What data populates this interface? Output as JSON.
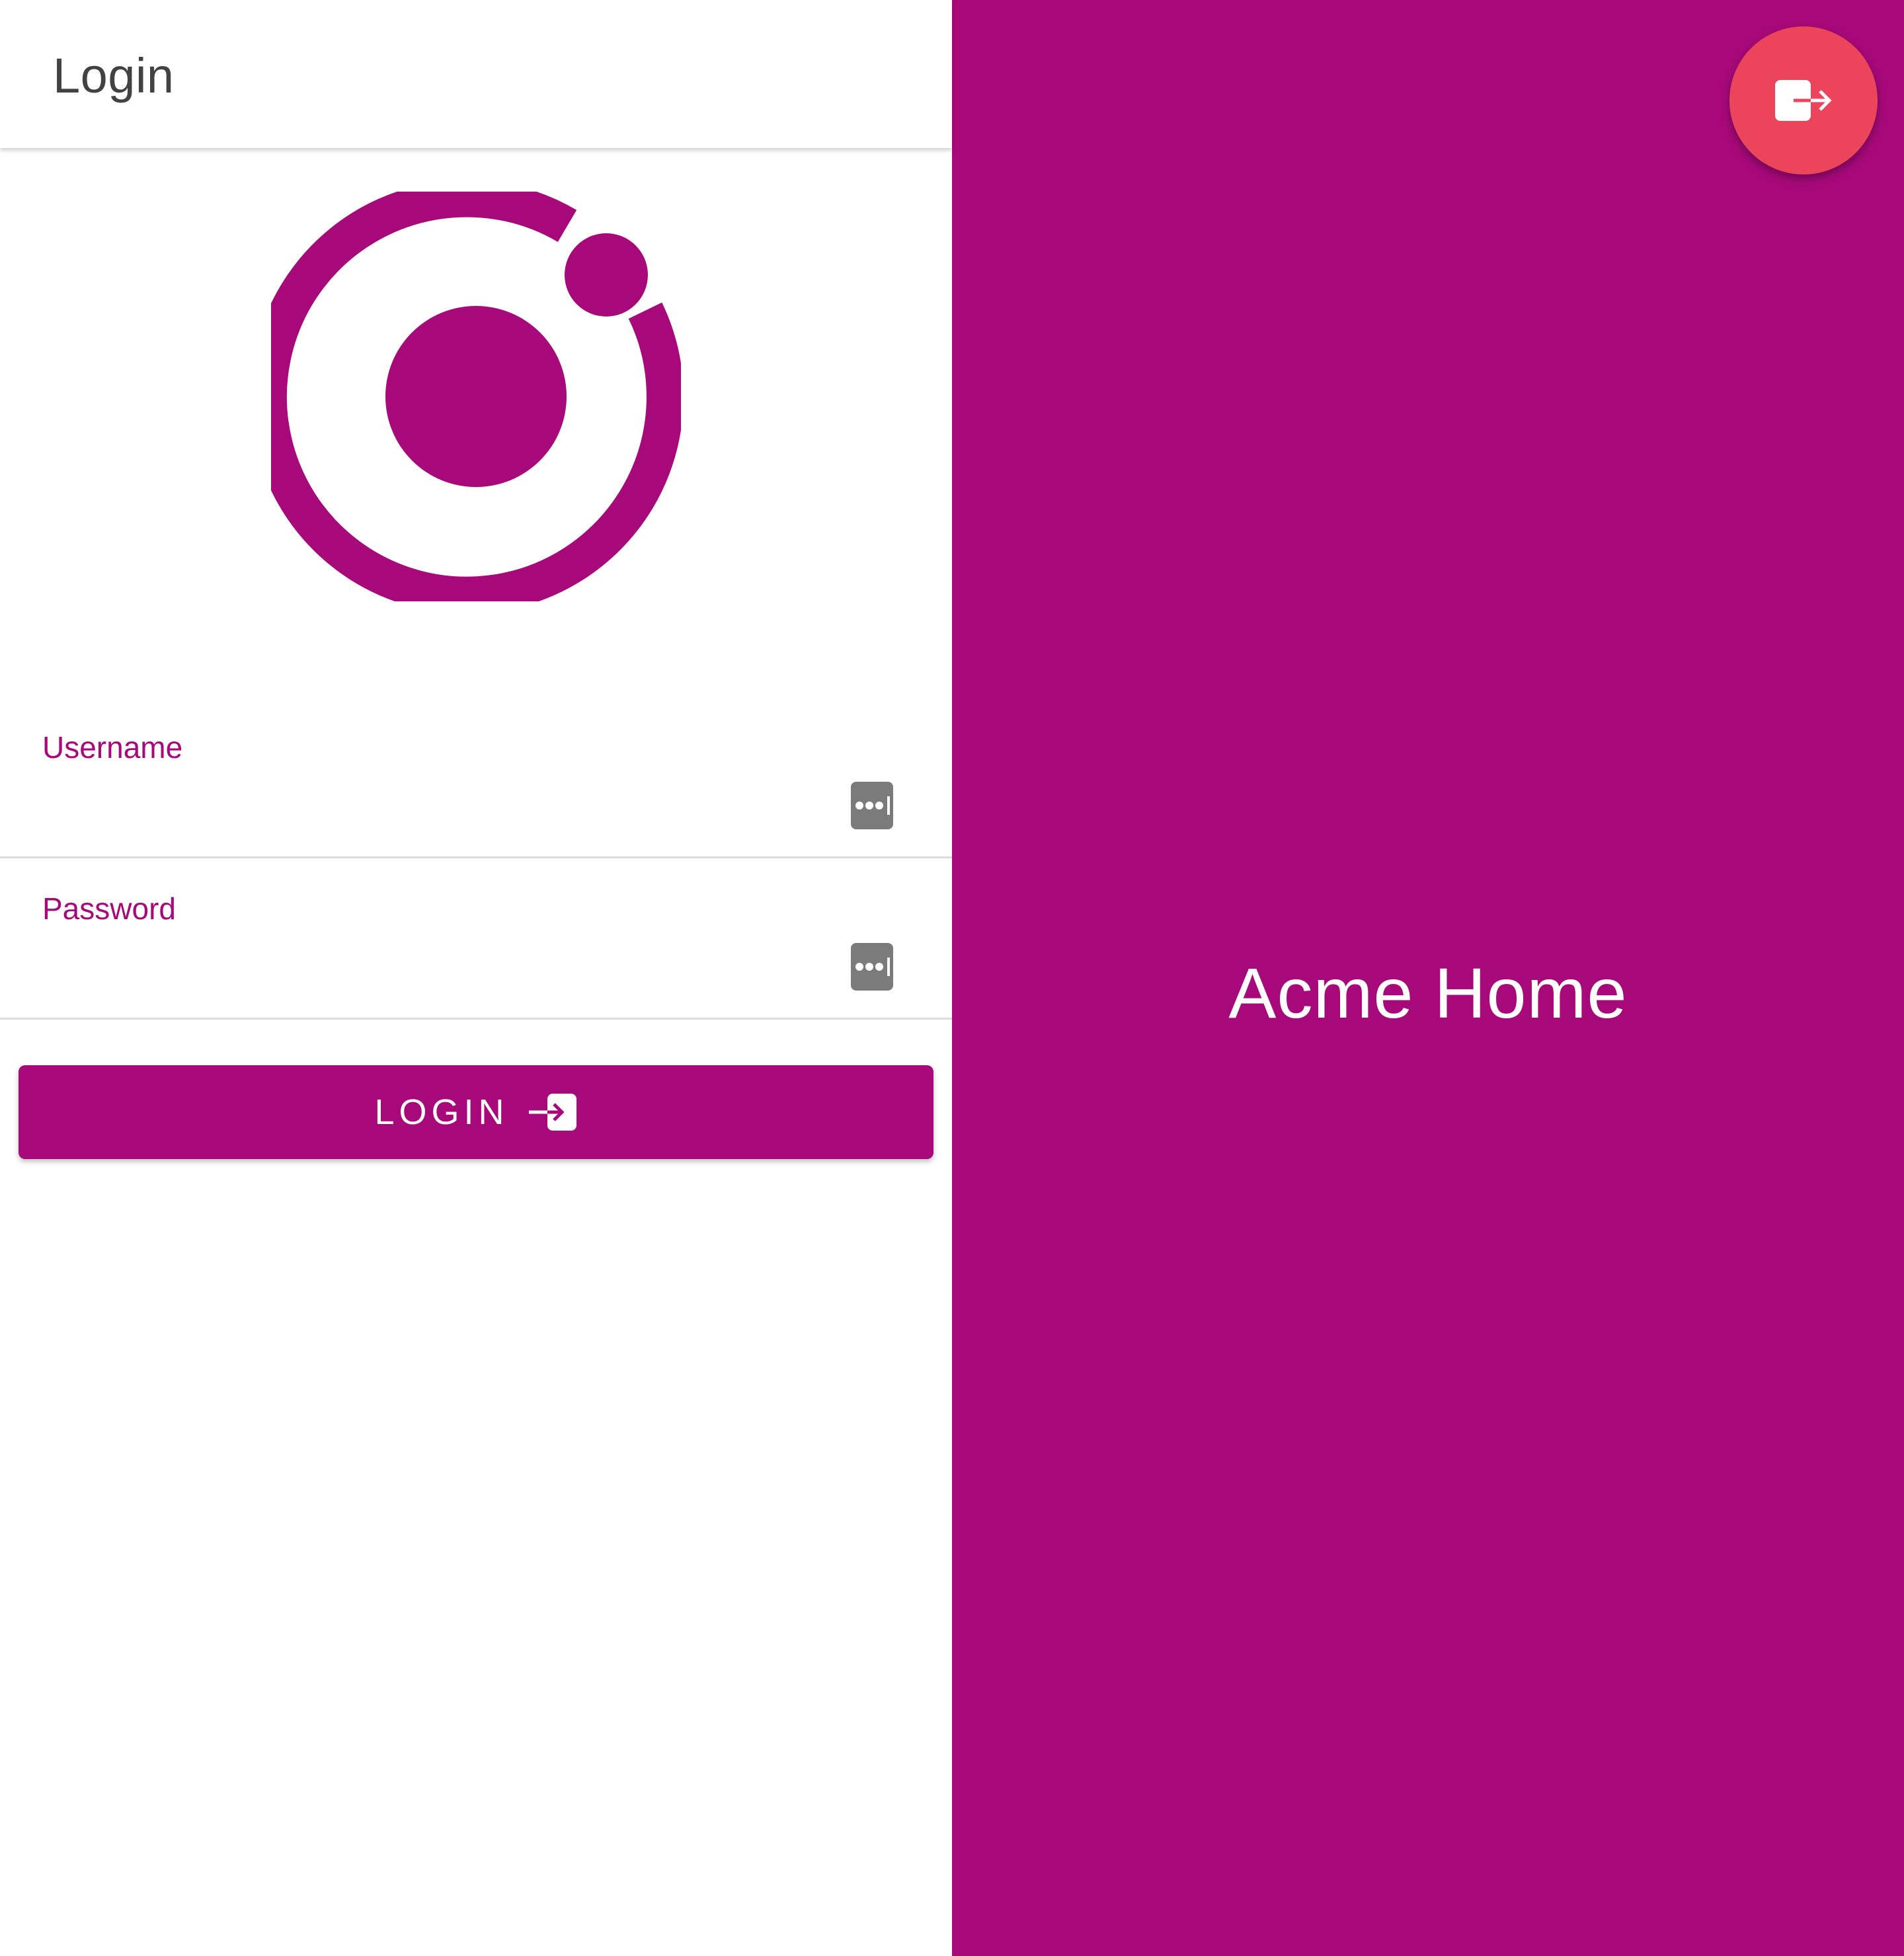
{
  "theme": {
    "primary": "#a8097a",
    "danger": "#ec445a",
    "toolbar_text": "#424242",
    "key_icon": "#7b7b7b"
  },
  "toolbar": {
    "title": "Login"
  },
  "logo": {
    "icon": "ionic-logo-icon"
  },
  "form": {
    "username": {
      "label": "Username",
      "value": "",
      "placeholder": "",
      "icon": "password-manager-key-icon"
    },
    "password": {
      "label": "Password",
      "value": "",
      "placeholder": "",
      "icon": "password-manager-key-icon"
    }
  },
  "login_button": {
    "label": "LOGIN",
    "icon": "log-in-icon"
  },
  "home": {
    "title": "Acme Home"
  },
  "fab": {
    "icon": "log-out-icon"
  }
}
